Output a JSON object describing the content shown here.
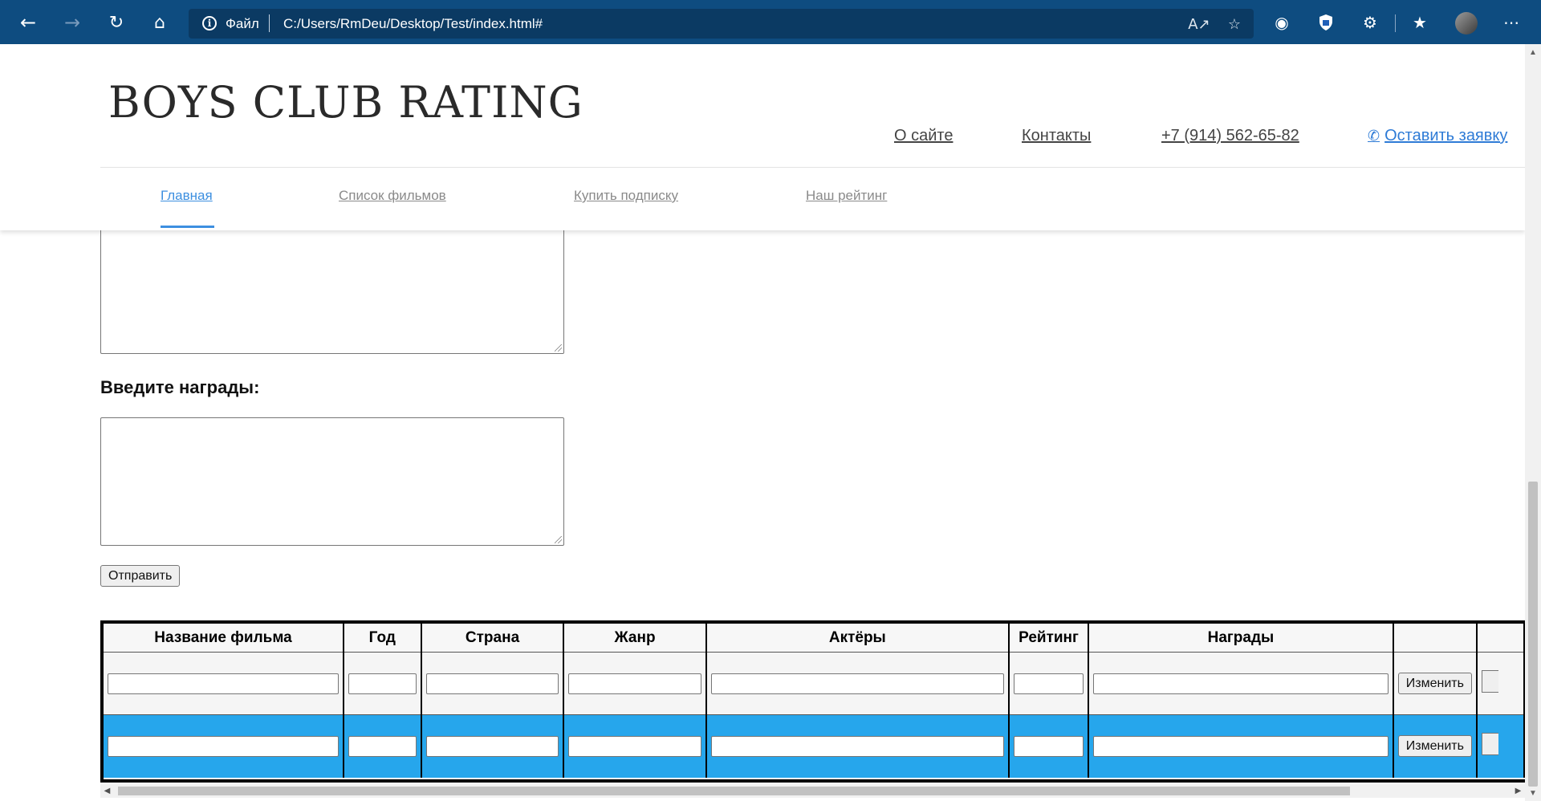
{
  "browser": {
    "scheme_label": "Файл",
    "url": "C:/Users/RmDeu/Desktop/Test/index.html#",
    "icons": [
      "back-icon",
      "forward-icon",
      "refresh-icon",
      "home-icon",
      "info-icon",
      "read-aloud-icon",
      "add-favorite-icon",
      "globe-icon",
      "shield-icon",
      "extensions-icon",
      "favorites-icon",
      "avatar",
      "more-icon"
    ]
  },
  "site": {
    "logo": "BOYS CLUB RATING",
    "links": {
      "about": "О сайте",
      "contacts": "Контакты",
      "phone": "+7 (914) 562-65-82",
      "lead": "Оставить заявку"
    },
    "menu": {
      "home": "Главная",
      "films": "Список фильмов",
      "subscribe": "Купить подписку",
      "rating": "Наш рейтинг"
    },
    "accent_color": "#3d8fe0"
  },
  "form": {
    "awards_label": "Введите награды:",
    "submit_label": "Отправить"
  },
  "table": {
    "headers": {
      "title": "Название фильма",
      "year": "Год",
      "country": "Страна",
      "genre": "Жанр",
      "actors": "Актёры",
      "rating": "Рейтинг",
      "awards": "Награды",
      "action": ""
    },
    "rows": [
      {
        "title": "",
        "year": "",
        "country": "",
        "genre": "",
        "actors": "",
        "rating": "",
        "awards": "",
        "edit_label": "Изменить"
      },
      {
        "title": "",
        "year": "",
        "country": "",
        "genre": "",
        "actors": "",
        "rating": "",
        "awards": "",
        "edit_label": "Изменить"
      }
    ],
    "highlight_row_color": "#26a6ec"
  }
}
